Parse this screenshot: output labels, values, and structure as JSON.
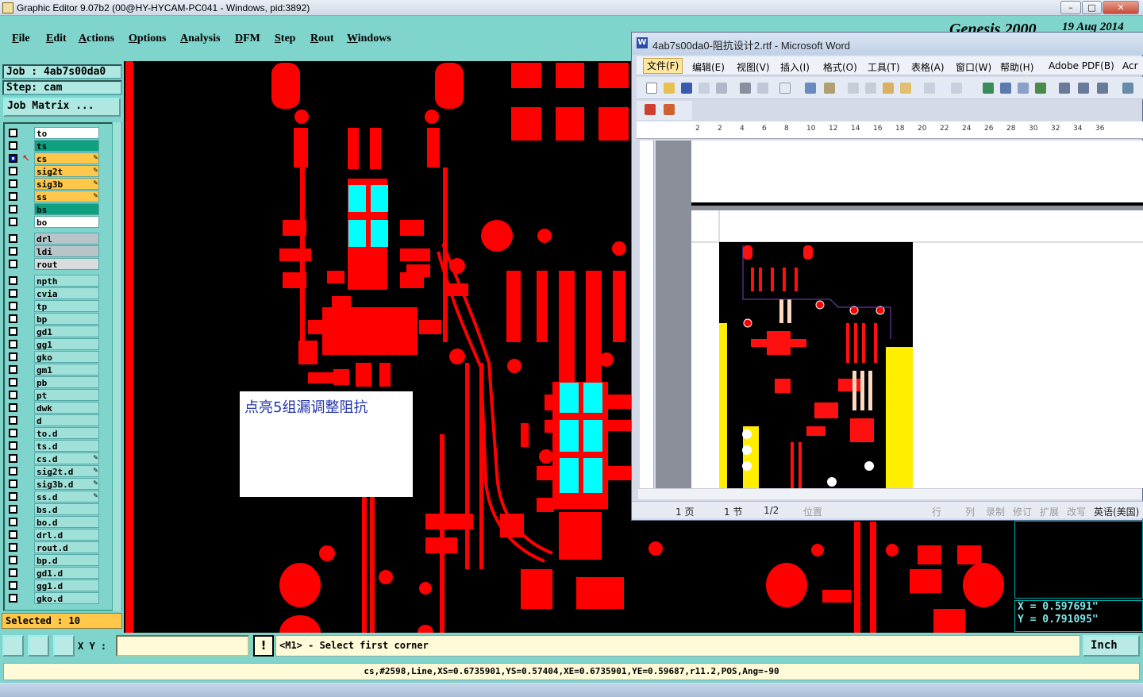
{
  "window": {
    "title": "Graphic Editor 9.07b2 (00@HY-HYCAM-PC041 - Windows, pid:3892)",
    "minimize": "–",
    "maximize": "□",
    "close": "✕"
  },
  "menu": [
    "File",
    "Edit",
    "Actions",
    "Options",
    "Analysis",
    "DFM",
    "Step",
    "Rout",
    "Windows"
  ],
  "job": {
    "job_line": "Job  :  4ab7s00da0",
    "step_line": "Step: cam",
    "matrix_button": "Job Matrix ..."
  },
  "layers": [
    {
      "name": "to",
      "color": "#ffffff",
      "active": false,
      "pen": false
    },
    {
      "name": "ts",
      "color": "#0fa080",
      "active": false,
      "pen": false
    },
    {
      "name": "cs",
      "color": "#ffc84a",
      "active": true,
      "pen": true
    },
    {
      "name": "sig2t",
      "color": "#ffc84a",
      "active": false,
      "pen": true
    },
    {
      "name": "sig3b",
      "color": "#ffc84a",
      "active": false,
      "pen": true
    },
    {
      "name": "ss",
      "color": "#ffc84a",
      "active": false,
      "pen": true
    },
    {
      "name": "bs",
      "color": "#0fa080",
      "active": false,
      "pen": false
    },
    {
      "name": "bo",
      "color": "#ffffff",
      "active": false,
      "pen": false
    },
    {
      "name": "drl",
      "color": "#b8c4c8",
      "active": false,
      "pen": false
    },
    {
      "name": "ldi",
      "color": "#b8c4c8",
      "active": false,
      "pen": false
    },
    {
      "name": "rout",
      "color": "#d8dcdc",
      "active": false,
      "pen": false
    },
    {
      "name": "npth",
      "color": "#9fe0d8",
      "active": false,
      "pen": false
    },
    {
      "name": "cvia",
      "color": "#9fe0d8",
      "active": false,
      "pen": false
    },
    {
      "name": "tp",
      "color": "#9fe0d8",
      "active": false,
      "pen": false
    },
    {
      "name": "bp",
      "color": "#9fe0d8",
      "active": false,
      "pen": false
    },
    {
      "name": "gd1",
      "color": "#9fe0d8",
      "active": false,
      "pen": false
    },
    {
      "name": "gg1",
      "color": "#9fe0d8",
      "active": false,
      "pen": false
    },
    {
      "name": "gko",
      "color": "#9fe0d8",
      "active": false,
      "pen": false
    },
    {
      "name": "gm1",
      "color": "#9fe0d8",
      "active": false,
      "pen": false
    },
    {
      "name": "pb",
      "color": "#9fe0d8",
      "active": false,
      "pen": false
    },
    {
      "name": "pt",
      "color": "#9fe0d8",
      "active": false,
      "pen": false
    },
    {
      "name": "dwk",
      "color": "#9fe0d8",
      "active": false,
      "pen": false
    },
    {
      "name": "d",
      "color": "#9fe0d8",
      "active": false,
      "pen": false
    },
    {
      "name": "to.d",
      "color": "#9fe0d8",
      "active": false,
      "pen": false
    },
    {
      "name": "ts.d",
      "color": "#9fe0d8",
      "active": false,
      "pen": false
    },
    {
      "name": "cs.d",
      "color": "#9fe0d8",
      "active": false,
      "pen": true
    },
    {
      "name": "sig2t.d",
      "color": "#9fe0d8",
      "active": false,
      "pen": true
    },
    {
      "name": "sig3b.d",
      "color": "#9fe0d8",
      "active": false,
      "pen": true
    },
    {
      "name": "ss.d",
      "color": "#9fe0d8",
      "active": false,
      "pen": true
    },
    {
      "name": "bs.d",
      "color": "#9fe0d8",
      "active": false,
      "pen": false
    },
    {
      "name": "bo.d",
      "color": "#9fe0d8",
      "active": false,
      "pen": false
    },
    {
      "name": "drl.d",
      "color": "#9fe0d8",
      "active": false,
      "pen": false
    },
    {
      "name": "rout.d",
      "color": "#9fe0d8",
      "active": false,
      "pen": false
    },
    {
      "name": "bp.d",
      "color": "#9fe0d8",
      "active": false,
      "pen": false
    },
    {
      "name": "gd1.d",
      "color": "#9fe0d8",
      "active": false,
      "pen": false
    },
    {
      "name": "gg1.d",
      "color": "#9fe0d8",
      "active": false,
      "pen": false
    },
    {
      "name": "gko.d",
      "color": "#9fe0d8",
      "active": false,
      "pen": false
    }
  ],
  "selected_label": "Selected : 10",
  "note_text": "点亮5组漏调整阻抗",
  "genesis": {
    "brand": "Genesis 2000",
    "date": "19 Aug 2014"
  },
  "word": {
    "title": "4ab7s00da0-阻抗设计2.rtf - Microsoft Word",
    "icon": "W",
    "menu": [
      "文件(F)",
      "编辑(E)",
      "视图(V)",
      "插入(I)",
      "格式(O)",
      "工具(T)",
      "表格(A)",
      "窗口(W)",
      "帮助(H)",
      "Adobe PDF(B)",
      "Acr"
    ],
    "ruler": [
      "2",
      "2",
      "4",
      "6",
      "8",
      "10",
      "12",
      "14",
      "16",
      "18",
      "20",
      "22",
      "24",
      "26",
      "28",
      "30",
      "32",
      "34",
      "36"
    ],
    "status": {
      "page": "1 页",
      "section": "1 节",
      "pages": "1/2",
      "position": "位置",
      "line": "行",
      "column": "列",
      "rec": "录制",
      "rev": "修订",
      "ext": "扩展",
      "ovr": "改写",
      "lang": "英语(美国)"
    }
  },
  "coords": {
    "x": "X  =  0.597691\"",
    "y": "Y  =  0.791095\""
  },
  "bottom": {
    "xy_label": "X Y :",
    "xy_value": "",
    "excl": "!",
    "prompt": "<M1> - Select first corner",
    "units": "Inch"
  },
  "status_line": "cs,#2598,Line,XS=0.6735901,YS=0.57404,XE=0.6735901,YE=0.59687,r11.2,POS,Ang=-90",
  "colors": {
    "copper": "#ff0000",
    "selected": "#00ffff",
    "background": "#000000"
  }
}
